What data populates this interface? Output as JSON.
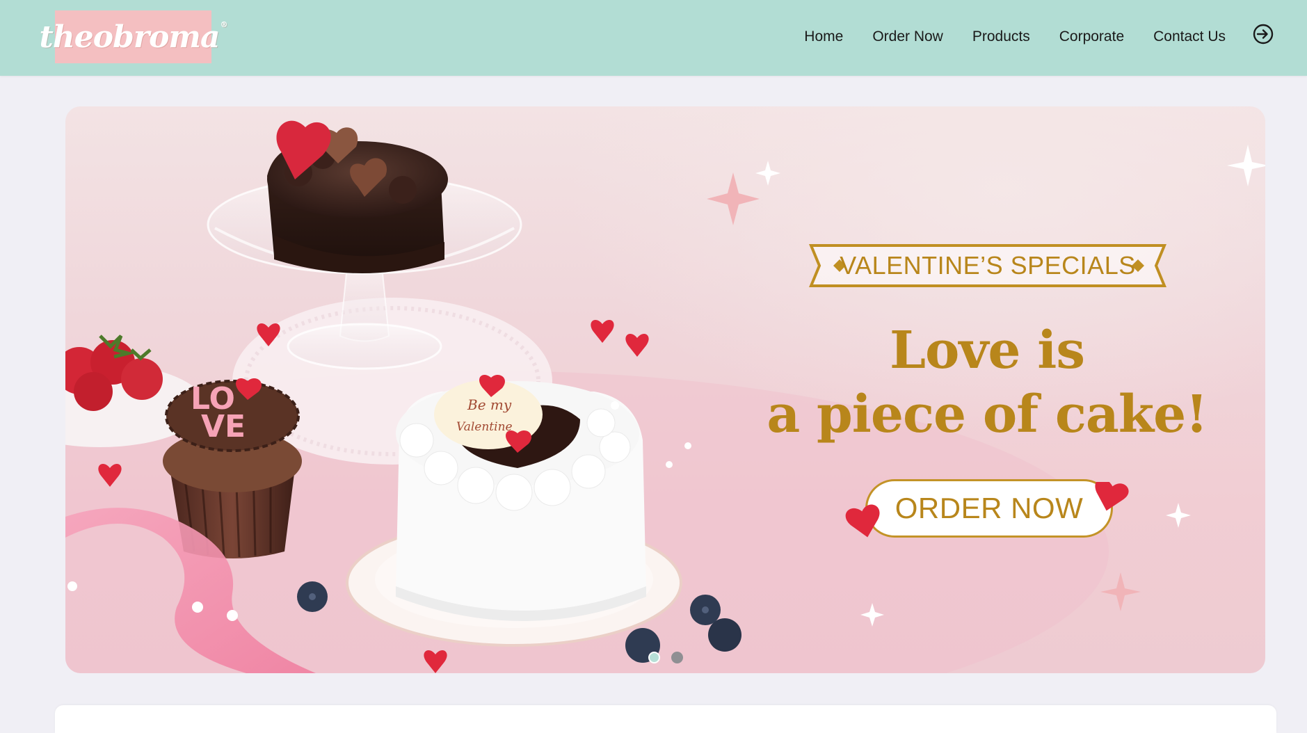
{
  "brand": {
    "name": "theobroma",
    "reg_mark": "®"
  },
  "nav": {
    "items": [
      {
        "label": "Home"
      },
      {
        "label": "Order Now"
      },
      {
        "label": "Products"
      },
      {
        "label": "Corporate"
      },
      {
        "label": "Contact Us"
      }
    ],
    "login_icon": "login-arrow-circle-icon"
  },
  "hero": {
    "badge": "VALENTINE’S SPECIALS",
    "headline_line1": "Love is",
    "headline_line2": "a piece of cake!",
    "cta_label": "ORDER NOW",
    "cake_plaque_line1": "Be my",
    "cake_plaque_line2": "Valentine",
    "cupcake_text_line1": "LO",
    "cupcake_text_line2": "VE",
    "slides_total": 2,
    "active_slide": 1
  },
  "colors": {
    "header_bg": "#b2ddd4",
    "logo_bg": "#f4bfc1",
    "page_bg": "#f0eff5",
    "accent_gold": "#b8861b",
    "heart_red": "#e0283c"
  }
}
